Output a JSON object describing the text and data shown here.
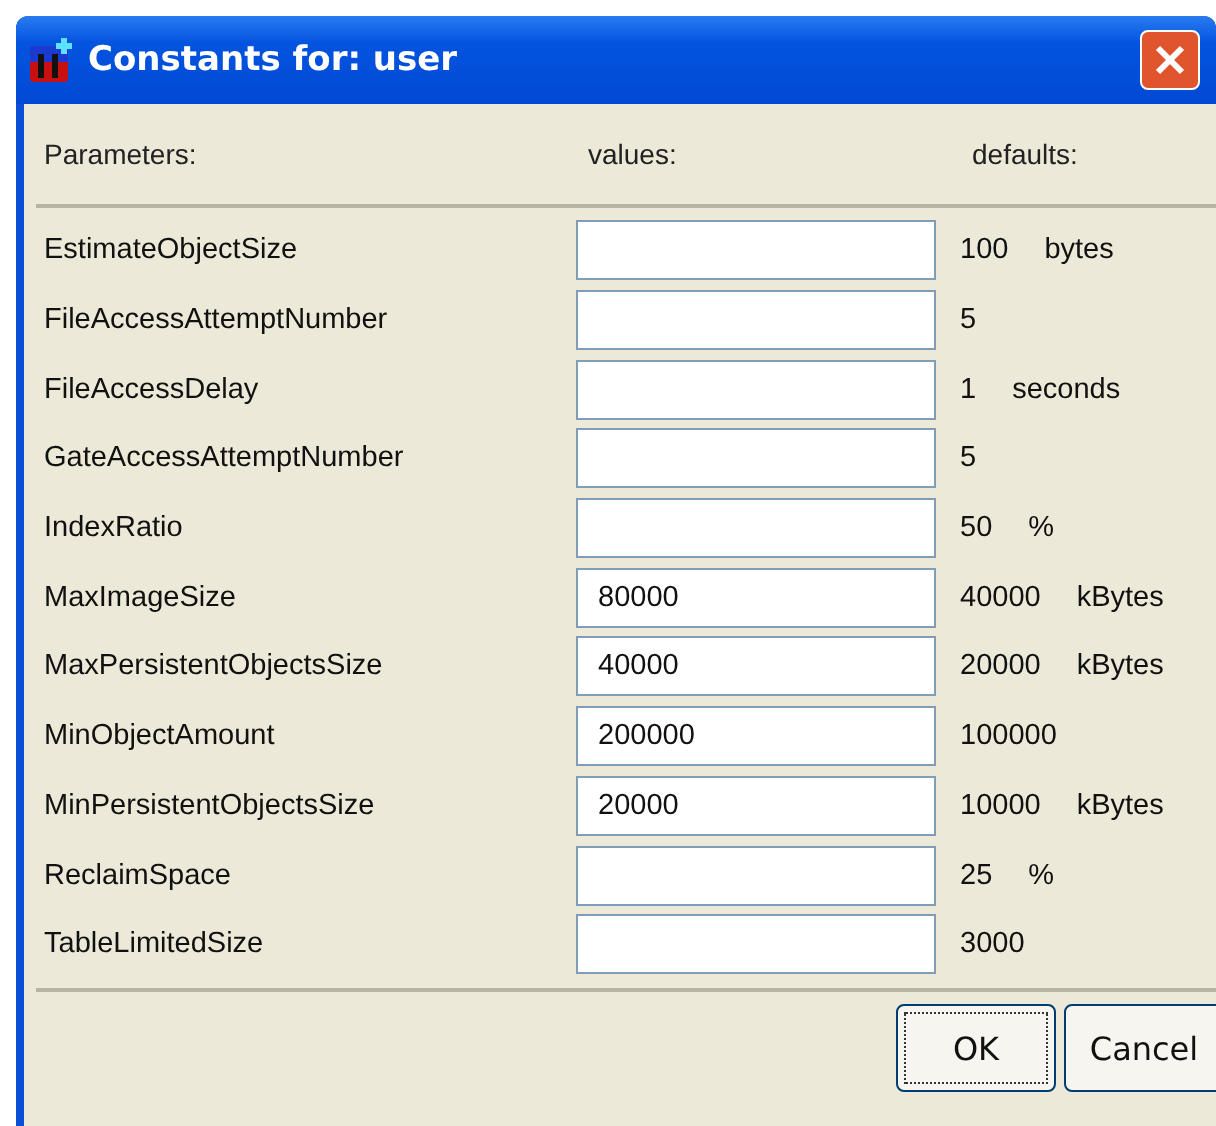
{
  "window": {
    "title": "Constants for: user"
  },
  "columns": [
    "Parameters:",
    "values:",
    "defaults:"
  ],
  "rows": [
    {
      "name": "EstimateObjectSize",
      "default": "100",
      "unit": "bytes"
    },
    {
      "name": "FileAccessAttemptNumber",
      "default": "5"
    },
    {
      "name": "FileAccessDelay",
      "default": "1",
      "unit": "seconds"
    },
    {
      "name": "GateAccessAttemptNumber",
      "default": "5"
    },
    {
      "name": "IndexRatio",
      "default": "50",
      "unit": "%"
    },
    {
      "name": "MaxImageSize",
      "value": "80000",
      "default": "40000",
      "unit": "kBytes"
    },
    {
      "name": "MaxPersistentObjectsSize",
      "value": "40000",
      "default": "20000",
      "unit": "kBytes"
    },
    {
      "name": "MinObjectAmount",
      "value": "200000",
      "default": "100000"
    },
    {
      "name": "MinPersistentObjectsSize",
      "value": "20000",
      "default": "10000",
      "unit": "kBytes"
    },
    {
      "name": "ReclaimSpace",
      "default": "25",
      "unit": "%"
    },
    {
      "name": "TableLimitedSize",
      "default": "3000"
    }
  ],
  "buttons": [
    "OK",
    "Cancel"
  ]
}
